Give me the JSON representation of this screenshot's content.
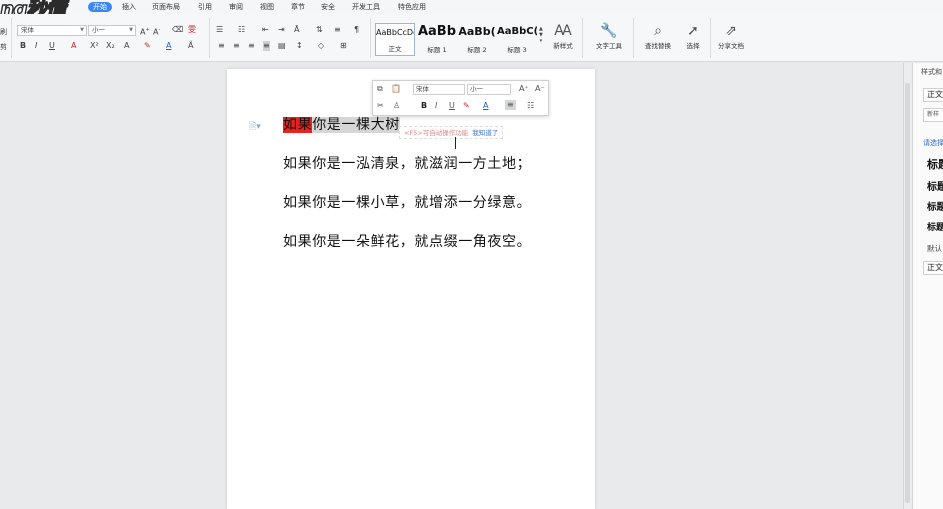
{
  "brand": {
    "logo_text": "ng秒懂"
  },
  "menu": {
    "items": [
      "开始",
      "插入",
      "页面布局",
      "引用",
      "审阅",
      "视图",
      "章节",
      "安全",
      "开发工具",
      "特色应用"
    ],
    "active_index": 0
  },
  "ribbon": {
    "font_name": "宋体",
    "font_size": "小一",
    "styles": [
      {
        "preview": "AaBbCcDd",
        "label": "正文"
      },
      {
        "preview": "AaBb",
        "label": "标题 1"
      },
      {
        "preview": "AaBb(",
        "label": "标题 2"
      },
      {
        "preview": "AaBbC(",
        "label": "标题 3"
      }
    ],
    "new_style_label": "新样式",
    "text_tool_label": "文字工具",
    "find_replace_label": "查找替换",
    "select_label": "选择",
    "share_label": "分享文档",
    "cut_partial": "剪",
    "paste_partial": "刷"
  },
  "mini_toolbar": {
    "font_name": "宋体",
    "font_size": "小一",
    "tip_text": "<F5>可自动操作功能",
    "tip_link": "我知道了"
  },
  "document": {
    "paragraphs": [
      {
        "highlight_red": "如果",
        "selected": "你是一棵大树",
        "rest": ""
      },
      {
        "text": "如果你是一泓清泉，就滋润一方土地；"
      },
      {
        "text": "如果你是一棵小草，就增添一分绿意。"
      },
      {
        "text": "如果你是一朵鲜花，就点缀一角夜空。"
      }
    ]
  },
  "right_pane": {
    "title": "样式和",
    "current_style": "正文",
    "new_style": "新样",
    "select_label": "请选择",
    "headings": [
      "标题",
      "标题",
      "标题",
      "标题"
    ],
    "default_label": "默认",
    "body_style": "正文"
  },
  "colors": {
    "accent": "#3b86f7",
    "highlight_red": "#e8231f",
    "selection_gray": "#d6d6d6",
    "link_blue": "#2b6ad8"
  }
}
